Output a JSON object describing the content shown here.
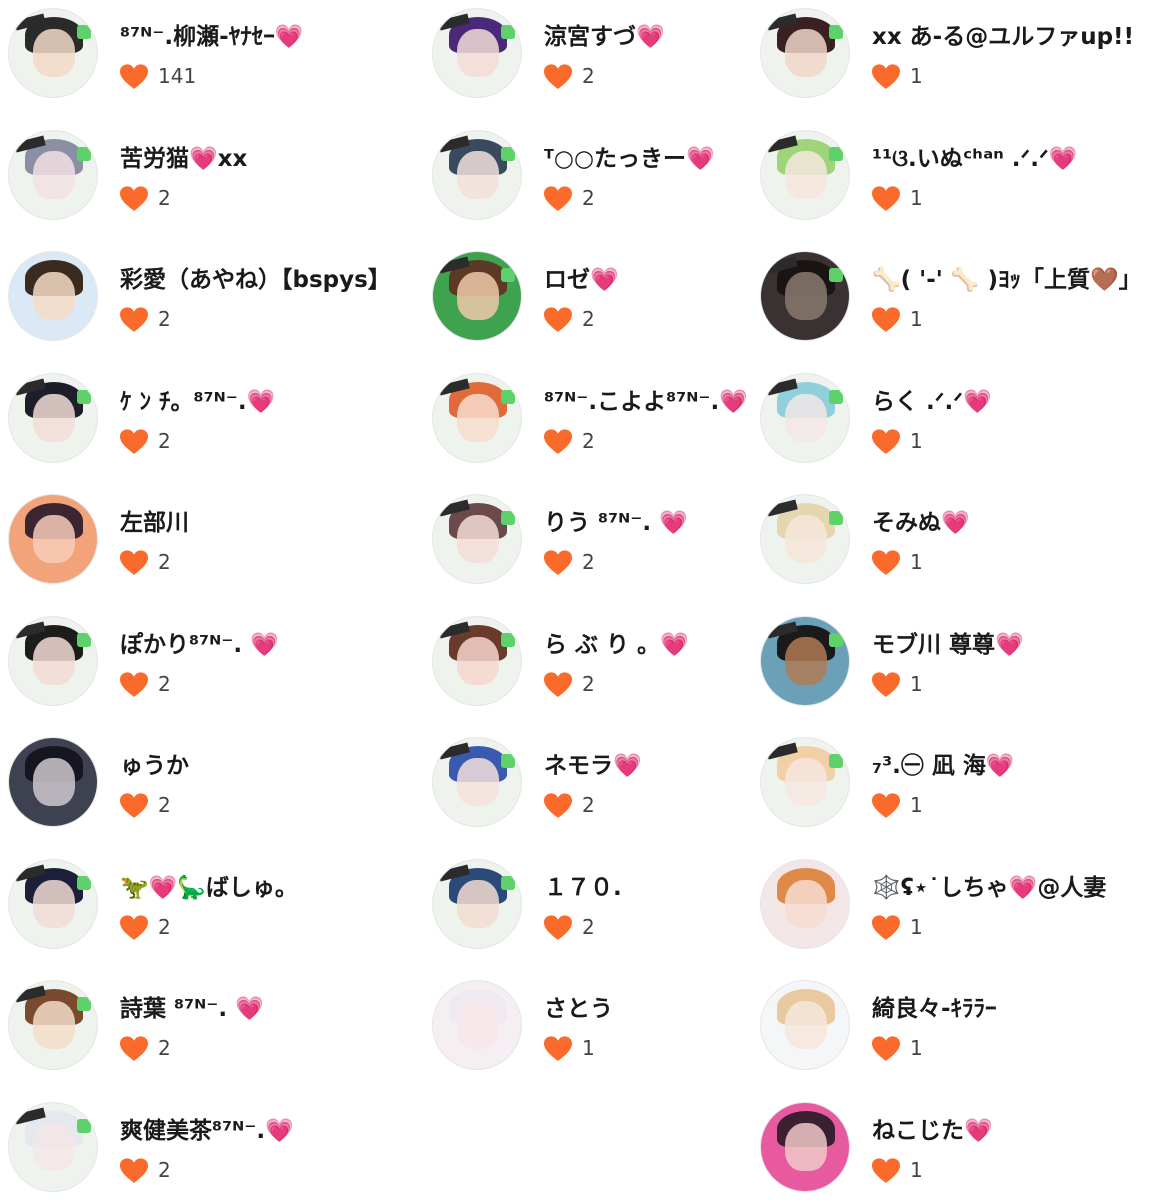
{
  "colors": {
    "heart": "#fa6a2a",
    "name_heart": "#ff3fa4",
    "text": "#1a1a1a",
    "count": "#444444",
    "badge_green": "#5fd16a"
  },
  "columns": [
    {
      "users": [
        {
          "name": "⁸⁷ᴺ⁻.柳瀬-ﾔﾅｾｰ💗",
          "likes": "141",
          "avatar": {
            "bg": "#eef3ee",
            "hair": "#2a2a2a",
            "face": "#f3d9c8",
            "variant": "crew-logo"
          }
        },
        {
          "name": "苦労猫💗xx",
          "likes": "2",
          "avatar": {
            "bg": "#eef3ee",
            "hair": "#8a8fa3",
            "face": "#f1e0e3",
            "variant": "crew-logo"
          }
        },
        {
          "name": "彩愛（あやね）【bspys】",
          "likes": "2",
          "avatar": {
            "bg": "#dbe8f6",
            "hair": "#3a2a20",
            "face": "#f6dcc6",
            "variant": "plain"
          }
        },
        {
          "name": "ｹ ﾝ ﾁ。⁸⁷ᴺ⁻.💗",
          "likes": "2",
          "avatar": {
            "bg": "#eef3ee",
            "hair": "#1e1e2a",
            "face": "#f1ddd6",
            "variant": "crew-logo"
          }
        },
        {
          "name": "左部川",
          "likes": "2",
          "avatar": {
            "bg": "#f3a37a",
            "hair": "#3b2530",
            "face": "#f7cdb8",
            "variant": "plain"
          }
        },
        {
          "name": "ぽかり⁸⁷ᴺ⁻. 💗",
          "likes": "2",
          "avatar": {
            "bg": "#eef3ee",
            "hair": "#1c1c1c",
            "face": "#f3dad6",
            "variant": "crew-logo"
          }
        },
        {
          "name": "ゅうか",
          "likes": "2",
          "avatar": {
            "bg": "#3e4150",
            "hair": "#161620",
            "face": "#cfc8cf",
            "variant": "plain"
          }
        },
        {
          "name": "🦖💗🦕ばしゅ。",
          "likes": "2",
          "avatar": {
            "bg": "#eef3ee",
            "hair": "#1b1f3a",
            "face": "#f1dcd6",
            "variant": "crew-logo"
          }
        },
        {
          "name": "詩葉 ⁸⁷ᴺ⁻. 💗",
          "likes": "2",
          "avatar": {
            "bg": "#eef3ee",
            "hair": "#7a4a2f",
            "face": "#f3dcc8",
            "variant": "crew-logo"
          }
        },
        {
          "name": "爽健美茶⁸⁷ᴺ⁻.💗",
          "likes": "2",
          "avatar": {
            "bg": "#eef3ee",
            "hair": "#e5e8ee",
            "face": "#f4e6e6",
            "variant": "crew-logo"
          }
        }
      ]
    },
    {
      "users": [
        {
          "name": "涼宮すづ💗",
          "likes": "2",
          "avatar": {
            "bg": "#eef3ee",
            "hair": "#4a2a78",
            "face": "#f3dcd6",
            "variant": "crew-logo"
          }
        },
        {
          "name": "ᵀ○○たっきー💗",
          "likes": "2",
          "avatar": {
            "bg": "#eef3ee",
            "hair": "#3a4a5e",
            "face": "#f1e0dc",
            "variant": "crew-logo"
          }
        },
        {
          "name": "ロゼ💗",
          "likes": "2",
          "avatar": {
            "bg": "#3fa24f",
            "hair": "#5a3a24",
            "face": "#f0c9a8",
            "variant": "crew-logo"
          }
        },
        {
          "name": "⁸⁷ᴺ⁻.こよよ⁸⁷ᴺ⁻.💗",
          "likes": "2",
          "avatar": {
            "bg": "#eef3ee",
            "hair": "#e06a3a",
            "face": "#f6dccc",
            "variant": "crew-logo"
          }
        },
        {
          "name": "りう ⁸⁷ᴺ⁻. 💗",
          "likes": "2",
          "avatar": {
            "bg": "#eef3ee",
            "hair": "#6a4a4a",
            "face": "#f3dcd6",
            "variant": "crew-logo"
          }
        },
        {
          "name": "ら ぶ り 。💗",
          "likes": "2",
          "avatar": {
            "bg": "#eef3ee",
            "hair": "#6a3a2a",
            "face": "#f6d6cc",
            "variant": "crew-logo"
          }
        },
        {
          "name": "ネモラ💗",
          "likes": "2",
          "avatar": {
            "bg": "#eef3ee",
            "hair": "#3a5ab0",
            "face": "#f3e0dc",
            "variant": "crew-logo"
          }
        },
        {
          "name": "１７０.",
          "likes": "2",
          "avatar": {
            "bg": "#eef3ee",
            "hair": "#2a4a7a",
            "face": "#f3dcd0",
            "variant": "crew-logo"
          }
        },
        {
          "name": "さとう",
          "likes": "1",
          "avatar": {
            "bg": "#f5eef3",
            "hair": "#eeeaf0",
            "face": "#f7e6ea",
            "variant": "plain"
          }
        }
      ]
    },
    {
      "users": [
        {
          "name": "xx あ-る@ユルファup!!",
          "likes": "1",
          "avatar": {
            "bg": "#eef3ee",
            "hair": "#3a2020",
            "face": "#f0d6c8",
            "variant": "crew-logo"
          }
        },
        {
          "name": "¹¹ଓ.いぬᶜʰᵃⁿ .ᐟ.ᐟ💗",
          "likes": "1",
          "avatar": {
            "bg": "#eef3ee",
            "hair": "#9ed47a",
            "face": "#f6e6dc",
            "variant": "crew-logo"
          }
        },
        {
          "name": "🦴( '-' 🦴 )ﾖｯ「上質🤎」",
          "likes": "1",
          "avatar": {
            "bg": "#3a3232",
            "hair": "#1a1414",
            "face": "#8a7a70",
            "variant": "crew-logo"
          }
        },
        {
          "name": "らく .ᐟ.ᐟ💗",
          "likes": "1",
          "avatar": {
            "bg": "#eef3ee",
            "hair": "#8fd0dc",
            "face": "#f3e6e6",
            "variant": "crew-logo"
          }
        },
        {
          "name": "そみぬ💗",
          "likes": "1",
          "avatar": {
            "bg": "#eef3ee",
            "hair": "#e6d6b0",
            "face": "#f6e6da",
            "variant": "crew-logo"
          }
        },
        {
          "name": "モブ川 尊尊💗",
          "likes": "1",
          "avatar": {
            "bg": "#6aa0b8",
            "hair": "#1a1a1a",
            "face": "#b07a54",
            "variant": "crew-logo"
          }
        },
        {
          "name": "₇³.㊀ 凪 海💗",
          "likes": "1",
          "avatar": {
            "bg": "#eef3ee",
            "hair": "#f1d0a8",
            "face": "#f6e6e0",
            "variant": "crew-logo"
          }
        },
        {
          "name": "🕸️ʢ⋆˙しちゃ💗@人妻",
          "likes": "1",
          "avatar": {
            "bg": "#f3e6e6",
            "hair": "#e08a4a",
            "face": "#f6dcd0",
            "variant": "plain"
          }
        },
        {
          "name": "綺良々-ｷﾗﾗｰ",
          "likes": "1",
          "avatar": {
            "bg": "#f4f6f8",
            "hair": "#e8c9a0",
            "face": "#f6e6dc",
            "variant": "plain"
          }
        },
        {
          "name": "ねこじた💗",
          "likes": "1",
          "avatar": {
            "bg": "#e85aa0",
            "hair": "#3a2030",
            "face": "#f0c8c8",
            "variant": "plain"
          }
        }
      ]
    }
  ]
}
